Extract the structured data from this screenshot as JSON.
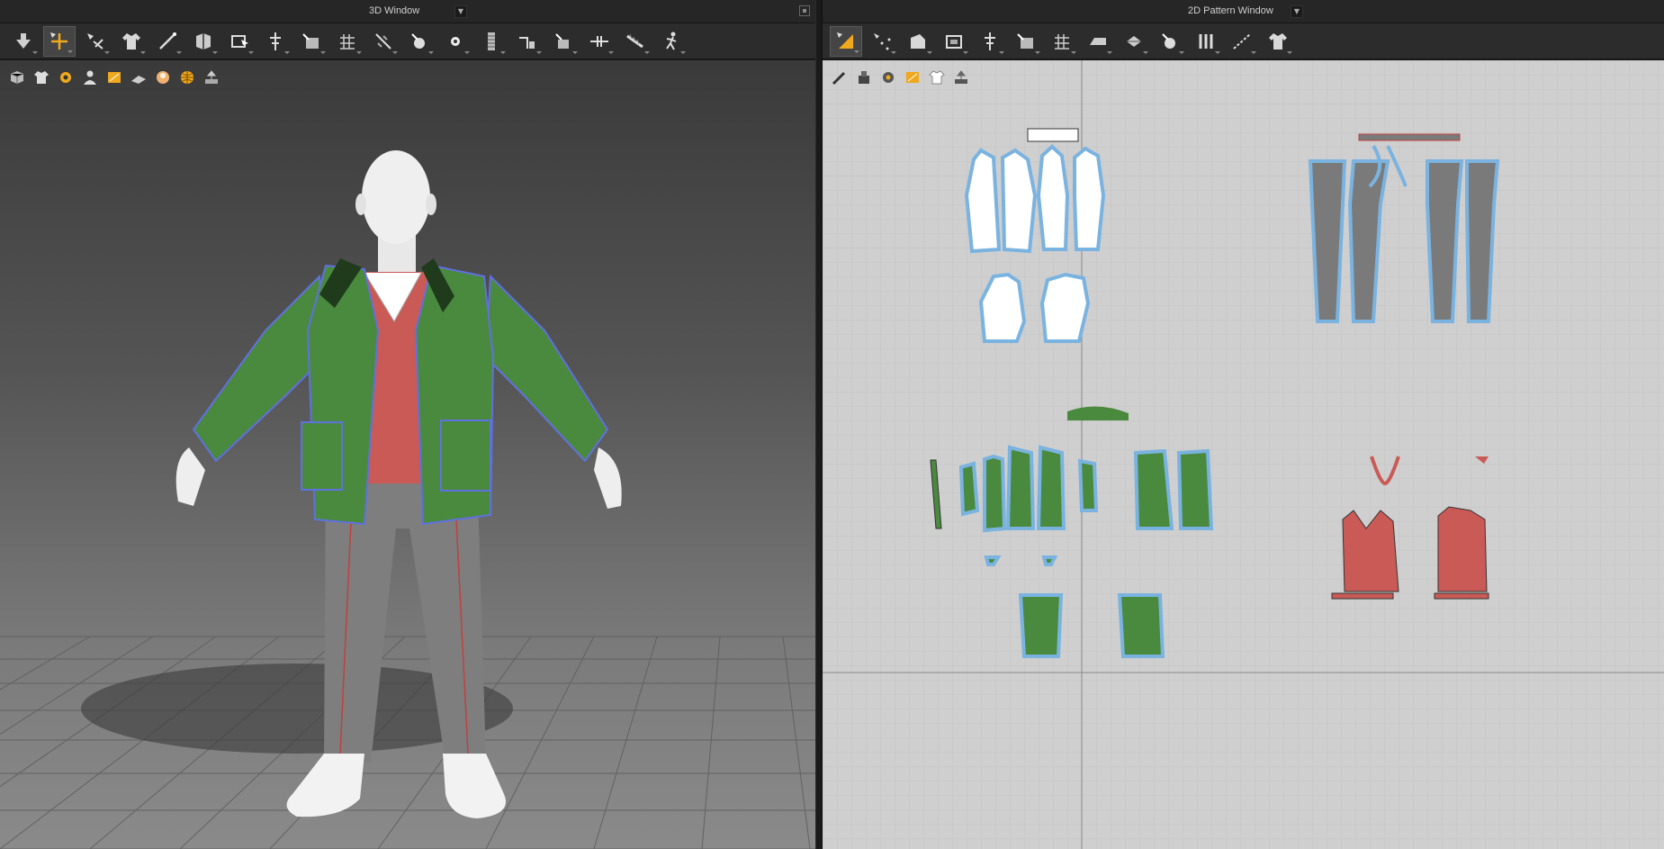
{
  "left_panel": {
    "title": "3D Window",
    "tools": [
      {
        "icon": "arrow-down-icon"
      },
      {
        "icon": "move-cross-icon",
        "active": true
      },
      {
        "icon": "select-mesh-icon"
      },
      {
        "icon": "garment-icon"
      },
      {
        "icon": "edit-curve-icon"
      },
      {
        "icon": "fold-icon"
      },
      {
        "icon": "transform-icon"
      },
      {
        "icon": "pin-icon"
      },
      {
        "icon": "box-pin-icon"
      },
      {
        "icon": "grid-icon"
      },
      {
        "icon": "needle-icon"
      },
      {
        "icon": "button-icon"
      },
      {
        "icon": "point-icon"
      },
      {
        "icon": "zipper-icon"
      },
      {
        "icon": "tape-icon"
      },
      {
        "icon": "measure-icon"
      },
      {
        "icon": "segment-icon"
      },
      {
        "icon": "ruler-icon"
      },
      {
        "icon": "avatar-walk-icon"
      }
    ],
    "subtools": [
      {
        "icon": "cube-icon"
      },
      {
        "icon": "shirt-icon"
      },
      {
        "icon": "gear-icon"
      },
      {
        "icon": "avatar-icon"
      },
      {
        "icon": "texture-icon"
      },
      {
        "icon": "plane-icon"
      },
      {
        "icon": "face-icon"
      },
      {
        "icon": "globe-icon"
      },
      {
        "icon": "export-icon"
      }
    ]
  },
  "right_panel": {
    "title": "2D Pattern Window",
    "tools": [
      {
        "icon": "transform-pattern-icon",
        "active": true
      },
      {
        "icon": "edit-point-icon"
      },
      {
        "icon": "polygon-icon"
      },
      {
        "icon": "rectangle-icon"
      },
      {
        "icon": "pin-icon"
      },
      {
        "icon": "box-pin-icon"
      },
      {
        "icon": "grid-icon"
      },
      {
        "icon": "iron-icon"
      },
      {
        "icon": "fold-icon"
      },
      {
        "icon": "button-icon"
      },
      {
        "icon": "seam-icon"
      },
      {
        "icon": "segment-icon"
      },
      {
        "icon": "shirt-icon"
      }
    ],
    "subtools": [
      {
        "icon": "brush-icon"
      },
      {
        "icon": "stamp-icon"
      },
      {
        "icon": "gear-icon"
      },
      {
        "icon": "texture-icon"
      },
      {
        "icon": "shirt-icon"
      },
      {
        "icon": "export-icon"
      }
    ]
  },
  "colors": {
    "jacket": "#4a8a3e",
    "sweater": "#c95a56",
    "pants": "#7a7a7a",
    "shirt": "#ffffff",
    "outline": "#7ab3e0",
    "accent": "#f0a81c"
  }
}
